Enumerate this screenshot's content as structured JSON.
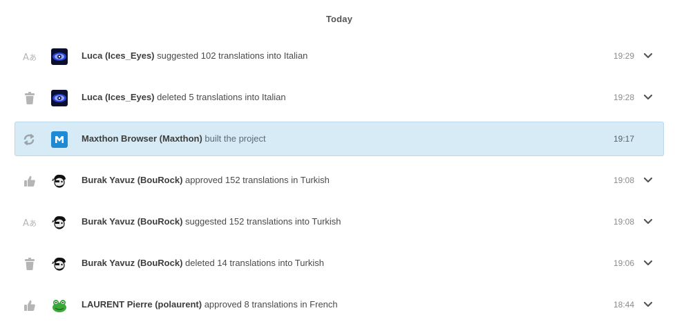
{
  "header": {
    "title": "Today"
  },
  "activities": [
    {
      "type": "suggest",
      "icon": "translate-icon",
      "avatar": "eye-avatar",
      "actor": "Luca (Ices_Eyes)",
      "action": "suggested 102 translations into Italian",
      "time": "19:29",
      "expandable": true
    },
    {
      "type": "delete",
      "icon": "trash-icon",
      "avatar": "eye-avatar",
      "actor": "Luca (Ices_Eyes)",
      "action": "deleted 5 translations into Italian",
      "time": "19:28",
      "expandable": true
    },
    {
      "type": "build",
      "icon": "refresh-icon",
      "avatar": "maxthon-logo",
      "actor": "Maxthon Browser (Maxthon)",
      "action": "built the project",
      "time": "19:17",
      "expandable": false
    },
    {
      "type": "approve",
      "icon": "thumbs-up-icon",
      "avatar": "pirate-avatar",
      "actor": "Burak Yavuz (BouRock)",
      "action": "approved 152 translations in Turkish",
      "time": "19:08",
      "expandable": true
    },
    {
      "type": "suggest",
      "icon": "translate-icon",
      "avatar": "pirate-avatar",
      "actor": "Burak Yavuz (BouRock)",
      "action": "suggested 152 translations into Turkish",
      "time": "19:08",
      "expandable": true
    },
    {
      "type": "delete",
      "icon": "trash-icon",
      "avatar": "pirate-avatar",
      "actor": "Burak Yavuz (BouRock)",
      "action": "deleted 14 translations into Turkish",
      "time": "19:06",
      "expandable": true
    },
    {
      "type": "approve",
      "icon": "thumbs-up-icon",
      "avatar": "frog-avatar",
      "actor": "LAURENT Pierre (polaurent)",
      "action": "approved 8 translations in French",
      "time": "18:44",
      "expandable": true
    }
  ],
  "colors": {
    "highlight_bg": "#d6ebf5",
    "highlight_border": "#b9d8ea",
    "icon_gray": "#b5b5b5",
    "maxthon_blue": "#1e8ad6"
  }
}
